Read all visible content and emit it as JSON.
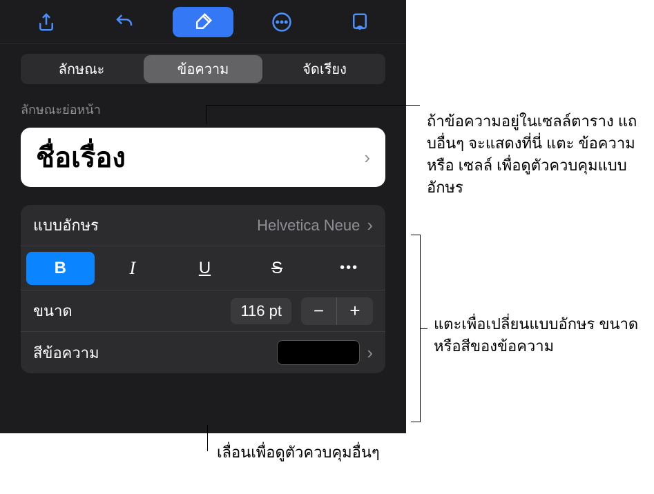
{
  "toolbar": {
    "share_icon": "share",
    "undo_icon": "undo",
    "format_icon": "brush",
    "more_icon": "ellipsis",
    "collab_icon": "doc-person"
  },
  "tabs": {
    "style": "ลักษณะ",
    "text": "ข้อความ",
    "arrange": "จัดเรียง"
  },
  "section": {
    "paragraph_styles_label": "ลักษณะย่อหน้า",
    "current_style": "ชื่อเรื่อง"
  },
  "font": {
    "label": "แบบอักษร",
    "value": "Helvetica Neue"
  },
  "style_buttons": {
    "bold": "B",
    "italic": "I",
    "underline": "U",
    "strike": "S",
    "more": "•••"
  },
  "size": {
    "label": "ขนาด",
    "value": "116 pt",
    "minus": "−",
    "plus": "+"
  },
  "text_color": {
    "label": "สีข้อความ",
    "swatch": "#000000"
  },
  "callouts": {
    "tabs_note": "ถ้าข้อความอยู่ในเซลล์ตาราง แถบอื่นๆ จะแสดงที่นี่ แตะ ข้อความ หรือ เซลล์ เพื่อดูตัวควบคุมแบบอักษร",
    "font_note": "แตะเพื่อเปลี่ยนแบบอักษร ขนาด หรือสีของข้อความ",
    "scroll_note": "เลื่อนเพื่อดูตัวควบคุมอื่นๆ"
  }
}
